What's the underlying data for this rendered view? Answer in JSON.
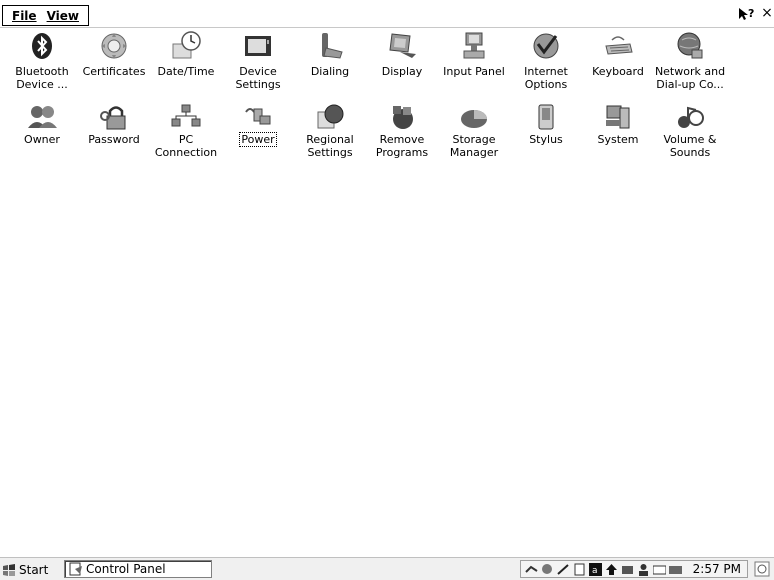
{
  "menubar": {
    "file_label": "File",
    "view_label": "View",
    "help_glyph": "?",
    "close_glyph": "×"
  },
  "items": [
    {
      "label": "Bluetooth\nDevice ...",
      "icon": "bluetooth-icon"
    },
    {
      "label": "Certificates",
      "icon": "certificates-icon"
    },
    {
      "label": "Date/Time",
      "icon": "clock-icon"
    },
    {
      "label": "Device\nSettings",
      "icon": "monitor-icon"
    },
    {
      "label": "Dialing",
      "icon": "phone-icon"
    },
    {
      "label": "Display",
      "icon": "display-icon"
    },
    {
      "label": "Input Panel",
      "icon": "input-panel-icon"
    },
    {
      "label": "Internet\nOptions",
      "icon": "globe-check-icon"
    },
    {
      "label": "Keyboard",
      "icon": "keyboard-icon"
    },
    {
      "label": "Network and\nDial-up Co...",
      "icon": "network-icon"
    },
    {
      "label": "Owner",
      "icon": "users-icon"
    },
    {
      "label": "Password",
      "icon": "password-icon"
    },
    {
      "label": "PC\nConnection",
      "icon": "pc-connection-icon"
    },
    {
      "label": "Power",
      "icon": "power-plug-icon"
    },
    {
      "label": "Regional\nSettings",
      "icon": "regional-globe-icon"
    },
    {
      "label": "Remove\nPrograms",
      "icon": "remove-programs-icon"
    },
    {
      "label": "Storage\nManager",
      "icon": "storage-pie-icon"
    },
    {
      "label": "Stylus",
      "icon": "stylus-icon"
    },
    {
      "label": "System",
      "icon": "system-icon"
    },
    {
      "label": "Volume &\nSounds",
      "icon": "volume-icon"
    }
  ],
  "selected_item": "Power",
  "taskbar": {
    "start_label": "Start",
    "task_label": "Control Panel",
    "clock": "2:57 PM"
  }
}
